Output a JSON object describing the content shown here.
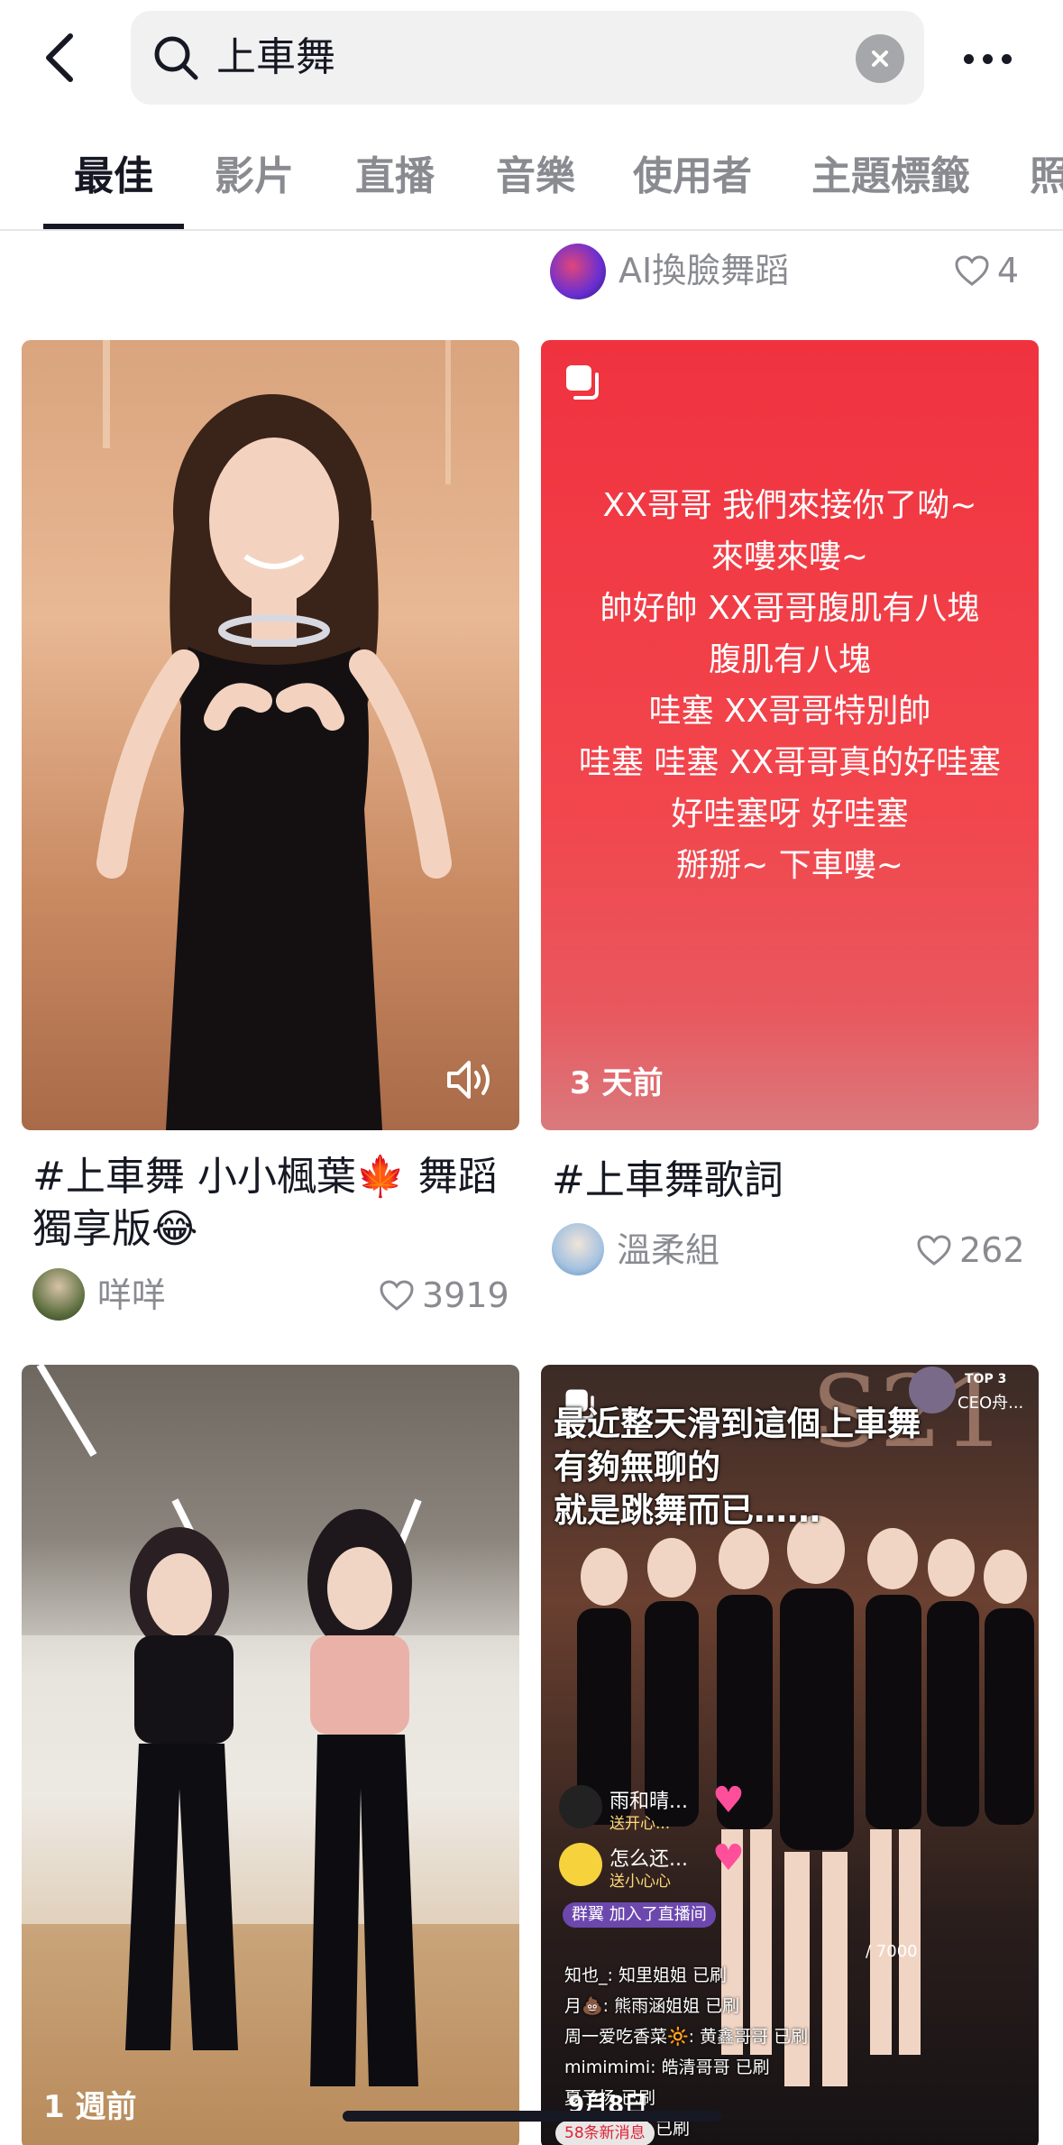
{
  "search": {
    "query": "上車舞"
  },
  "tabs": [
    {
      "label": "最佳",
      "active": true
    },
    {
      "label": "影片"
    },
    {
      "label": "直播"
    },
    {
      "label": "音樂"
    },
    {
      "label": "使用者"
    },
    {
      "label": "主題標籤"
    },
    {
      "label": "照"
    }
  ],
  "prev_card": {
    "author": "AI換臉舞蹈",
    "likes": "4"
  },
  "cards": [
    {
      "title": "#上車舞 小小楓葉🍁 舞蹈獨享版😂",
      "author": "咩咩",
      "likes": "3919",
      "has_sound_icon": true
    },
    {
      "lyrics": [
        "XX哥哥 我們來接你了呦~",
        "來嘍來嘍~",
        "帥好帥 XX哥哥腹肌有八塊",
        "腹肌有八塊",
        "哇塞 XX哥哥特別帥",
        "哇塞 哇塞 XX哥哥真的好哇塞",
        "好哇塞呀 好哇塞",
        "掰掰~ 下車嘍~"
      ],
      "time": "3 天前",
      "title": "#上車舞歌詞",
      "author": "溫柔組",
      "likes": "262"
    },
    {
      "time": "1 週前"
    },
    {
      "overlay_lines": [
        "最近整天滑到這個上車舞",
        "有夠無聊的",
        "就是跳舞而已……"
      ],
      "comments": [
        {
          "name": "雨和晴...",
          "sub": "送开心..."
        },
        {
          "name": "怎么还...",
          "sub": "送小心心"
        }
      ],
      "join_msg": "群翼 加入了直播间",
      "chat": [
        "知也_: 知里姐姐 已刷",
        "月💩: 熊雨涵姐姐 已刷",
        "周一爱吃香菜🔆: 黄鑫哥哥 已刷",
        "mimimimi: 皓清哥哥 已刷",
        "夏予扬 已刷",
        "熊雨涵姐姐 已刷"
      ],
      "top_label": "TOP 3",
      "host": "CEO舟...",
      "score": "/ 7000",
      "date_text": "9月8日",
      "new_msg": "58条新消息"
    }
  ],
  "colors": {
    "accent_red": "#f23547",
    "text": "#161823",
    "muted": "#8a8b91"
  }
}
